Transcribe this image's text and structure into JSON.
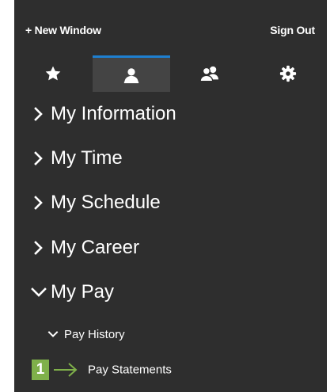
{
  "header": {
    "new_window_label": "+ New Window",
    "sign_out_label": "Sign Out"
  },
  "tabs": [
    {
      "name": "favorites",
      "icon": "star-icon",
      "active": false
    },
    {
      "name": "my-info",
      "icon": "person-icon",
      "active": true
    },
    {
      "name": "team",
      "icon": "people-icon",
      "active": false
    },
    {
      "name": "settings",
      "icon": "gear-icon",
      "active": false
    }
  ],
  "nav": {
    "items": [
      {
        "label": "My Information",
        "expanded": false
      },
      {
        "label": "My Time",
        "expanded": false
      },
      {
        "label": "My Schedule",
        "expanded": false
      },
      {
        "label": "My Career",
        "expanded": false
      },
      {
        "label": "My Pay",
        "expanded": true
      }
    ],
    "pay_history": {
      "label": "Pay History",
      "expanded": true
    },
    "pay_statements": {
      "label": "Pay Statements"
    }
  },
  "callout": {
    "step_number": "1",
    "color": "#7fb04a"
  },
  "colors": {
    "panel_bg": "#2e2e2e",
    "active_tab_bg": "#444444",
    "active_tab_accent": "#1e7fd0",
    "text": "#ffffff"
  }
}
